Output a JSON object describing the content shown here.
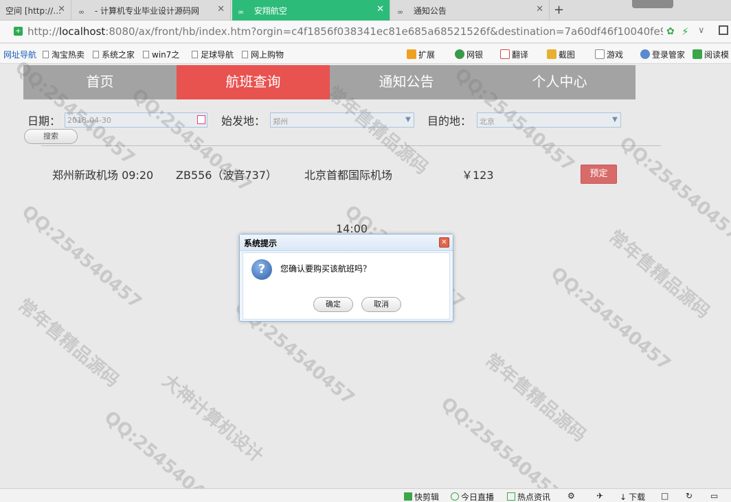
{
  "browser": {
    "tabs": [
      {
        "label": "空间 [http://…"
      },
      {
        "label": "- 计算机专业毕业设计源码网"
      },
      {
        "label": "安翔航空"
      },
      {
        "label": "通知公告"
      }
    ],
    "new_tab_label": "+",
    "url_prefix": "http://",
    "url_host": "localhost",
    "url_rest": ":8080/ax/front/hb/index.htm?orgin=c4f1856f038341ec81e685a68521526f&destination=7a60df46f10040fe91d6",
    "bookmarks": [
      "网址导航",
      "淘宝热卖",
      "系统之家",
      "win7之",
      "足球导航",
      "网上购物"
    ],
    "toolbar": [
      "扩展",
      "网银",
      "翻译",
      "截图",
      "游戏",
      "登录管家",
      "阅读模"
    ]
  },
  "nav": [
    "首页",
    "航班查询",
    "通知公告",
    "个人中心"
  ],
  "search": {
    "date_label": "日期：",
    "date_value": "2018-04-30",
    "from_label": "始发地：",
    "from_value": "郑州",
    "to_label": "目的地：",
    "to_value": "北京",
    "button": "搜索"
  },
  "flight": {
    "depart": "郑州新政机场 09:20",
    "code": "ZB556（波音737）",
    "arrive": "北京首都国际机场",
    "price": "￥123",
    "book": "预定",
    "arrive_time": "14:00"
  },
  "dialog": {
    "title": "系统提示",
    "message": "您确认要购买该航班吗？",
    "ok": "确定",
    "cancel": "取消"
  },
  "watermarks": [
    "QQ:254540457",
    "常年售精品源码",
    "大神计算机设计"
  ],
  "statusbar": [
    "快剪辑",
    "今日直播",
    "热点资讯",
    "下载"
  ]
}
